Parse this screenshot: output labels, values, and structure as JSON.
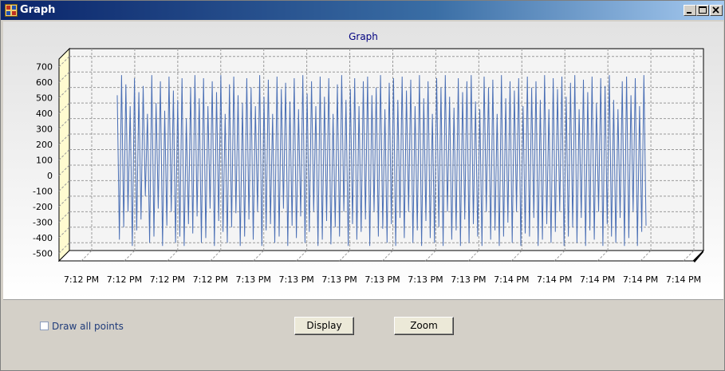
{
  "window": {
    "title": "Graph",
    "controls": {
      "minimize": "minimize",
      "maximize": "maximize",
      "close": "close"
    }
  },
  "chart": {
    "title": "Graph"
  },
  "controls": {
    "draw_all_points_label": "Draw all points",
    "draw_all_points_checked": false,
    "display_button": "Display",
    "zoom_button": "Zoom"
  },
  "colors": {
    "series": "#4a6fb5",
    "title": "#000080",
    "grid": "#9a9a9a"
  },
  "chart_data": {
    "type": "line",
    "title": "Graph",
    "xlabel": "",
    "ylabel": "",
    "ylim": [
      -550,
      750
    ],
    "y_ticks": [
      700,
      600,
      500,
      400,
      300,
      200,
      100,
      0,
      -100,
      -200,
      -300,
      -400,
      -500
    ],
    "x_tick_labels": [
      "7:12 PM",
      "7:12 PM",
      "7:12 PM",
      "7:12 PM",
      "7:13 PM",
      "7:13 PM",
      "7:13 PM",
      "7:13 PM",
      "7:13 PM",
      "7:13 PM",
      "7:14 PM",
      "7:14 PM",
      "7:14 PM",
      "7:14 PM",
      "7:14 PM"
    ],
    "grid": true,
    "legend": "none",
    "series": [
      {
        "values": [
          450,
          -480,
          580,
          -400,
          520,
          -300,
          380,
          -520,
          560,
          -420,
          470,
          -350,
          510,
          -200,
          330,
          -500,
          580,
          -460,
          400,
          -280,
          540,
          -520,
          350,
          -390,
          570,
          -300,
          480,
          -500,
          420,
          -460,
          560,
          -520,
          300,
          -380,
          500,
          -440,
          580,
          -330,
          430,
          -500,
          560,
          -470,
          380,
          -280,
          540,
          -520,
          470,
          -360,
          580,
          -430,
          330,
          -500,
          520,
          -400,
          570,
          -310,
          450,
          -520,
          400,
          -460,
          560,
          -350,
          500,
          -480,
          380,
          -300,
          580,
          -520,
          440,
          -420,
          550,
          -380,
          330,
          -500,
          570,
          -460,
          490,
          -280,
          530,
          -520,
          410,
          -390,
          560,
          -470,
          360,
          -330,
          580,
          -500,
          460,
          -430,
          540,
          -300,
          380,
          -520,
          570,
          -480,
          440,
          -360,
          560,
          -510,
          330,
          -400,
          520,
          -460,
          580,
          -300,
          420,
          -520,
          490,
          -380,
          560,
          -480,
          380,
          -430,
          540,
          -350,
          570,
          -520,
          450,
          -300,
          500,
          -460,
          580,
          -410,
          360,
          -500,
          530,
          -380,
          560,
          -520,
          420,
          -340,
          570,
          -470,
          480,
          -300,
          550,
          -500,
          380,
          -420,
          580,
          -520,
          430,
          -360,
          540,
          -470,
          330,
          -500,
          560,
          -400,
          500,
          -520,
          580,
          -300,
          440,
          -480,
          370,
          -420,
          560,
          -520,
          470,
          -350,
          540,
          -500,
          580,
          -380,
          410,
          -460,
          360,
          -520,
          570,
          -300,
          500,
          -480,
          550,
          -420,
          330,
          -520,
          580,
          -460,
          430,
          -370,
          540,
          -500,
          480,
          -300,
          560,
          -520,
          380,
          -440,
          570,
          -460,
          500,
          -340,
          540,
          -520,
          420,
          -480,
          580,
          -380,
          360,
          -500,
          560,
          -430,
          490,
          -300,
          570,
          -520,
          440,
          -460,
          530,
          -400,
          580,
          -500,
          360,
          -340,
          550,
          -520,
          470,
          -420,
          570,
          -480,
          400,
          -300,
          560,
          -520,
          510,
          -380,
          580,
          -460,
          420,
          -500,
          360,
          -340,
          540,
          -520,
          570,
          -470,
          450,
          -300,
          560,
          -520,
          380,
          -430,
          580,
          -390
        ]
      }
    ]
  }
}
